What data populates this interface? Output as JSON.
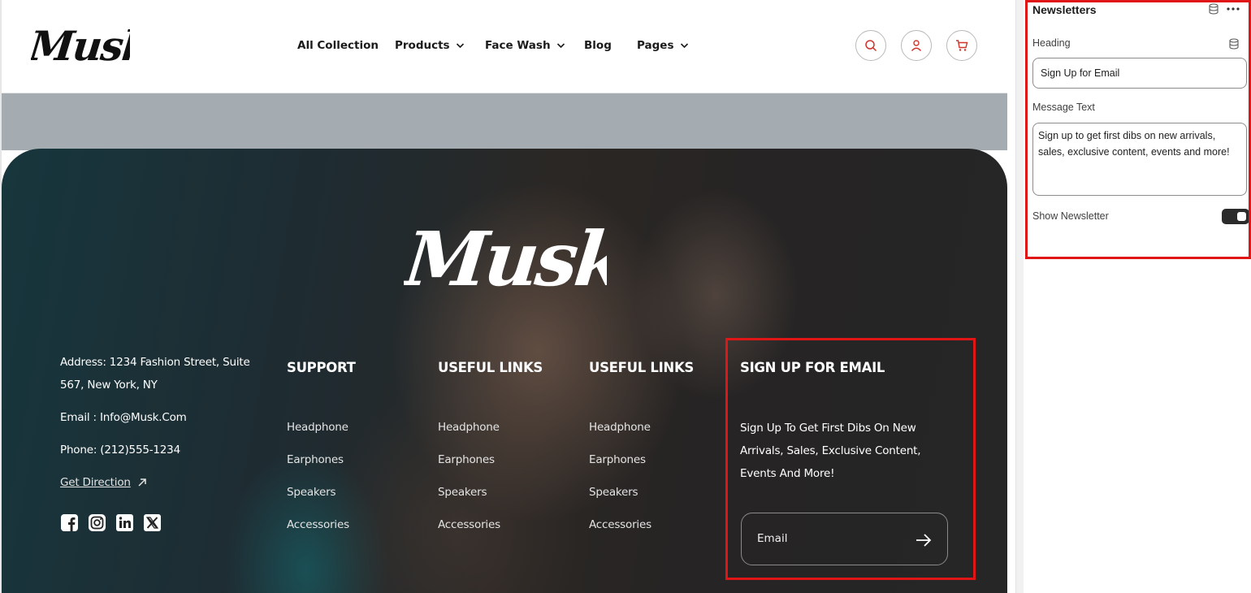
{
  "colors": {
    "highlight": "#e01616",
    "footer_bg": "#262626",
    "hero_strip": "#a4abb1",
    "accent_icon": "#d0342c",
    "toggle_on": "#2b2b2b"
  },
  "header": {
    "logo_text": "Musk",
    "nav": [
      {
        "label": "All Collection",
        "has_dropdown": false
      },
      {
        "label": "Products",
        "has_dropdown": true
      },
      {
        "label": "Face Wash",
        "has_dropdown": true
      },
      {
        "label": "Blog",
        "has_dropdown": false
      },
      {
        "label": "Pages",
        "has_dropdown": true
      }
    ],
    "icons": [
      "search-icon",
      "user-icon",
      "cart-icon"
    ]
  },
  "footer": {
    "logo_text": "Musk",
    "contact": {
      "address": "Address: 1234 Fashion Street, Suite 567, New York, NY",
      "email": "Email : Info@Musk.Com",
      "phone": "Phone: (212)555-1234",
      "direction": "Get Direction"
    },
    "social": [
      "facebook-icon",
      "instagram-icon",
      "linkedin-icon",
      "x-icon"
    ],
    "columns": [
      {
        "title": "SUPPORT",
        "links": [
          "Headphone",
          "Earphones",
          "Speakers",
          "Accessories"
        ]
      },
      {
        "title": "USEFUL LINKS",
        "links": [
          "Headphone",
          "Earphones",
          "Speakers",
          "Accessories"
        ]
      },
      {
        "title": "USEFUL LINKS",
        "links": [
          "Headphone",
          "Earphones",
          "Speakers",
          "Accessories"
        ]
      }
    ],
    "signup": {
      "title": "SIGN UP FOR EMAIL",
      "message": "Sign Up To Get First Dibs On New Arrivals, Sales, Exclusive Content, Events And More!",
      "placeholder": "Email"
    }
  },
  "panel": {
    "title": "Newsletters",
    "heading_label": "Heading",
    "heading_value": "Sign Up for Email",
    "message_label": "Message Text",
    "message_value": "Sign up to get first dibs on new arrivals, sales, exclusive content, events and more!",
    "show_label": "Show Newsletter",
    "show_newsletter": true
  }
}
